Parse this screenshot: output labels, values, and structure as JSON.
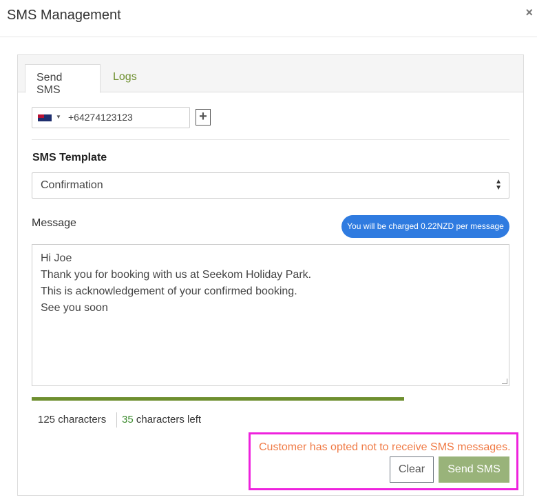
{
  "modal": {
    "title": "SMS Management",
    "close_glyph": "×"
  },
  "tabs": [
    {
      "label": "Send SMS",
      "active": true
    },
    {
      "label": "Logs",
      "active": false
    }
  ],
  "phone": {
    "country_flag": "nz-flag-icon",
    "value": "+64274123123",
    "add_glyph": "+"
  },
  "template": {
    "label": "SMS Template",
    "selected": "Confirmation"
  },
  "message": {
    "label": "Message",
    "charge_notice": "You will be charged 0.22NZD per message",
    "lines": [
      "Hi Joe",
      "Thank you for booking with us at Seekom Holiday Park.",
      "This is acknowledgement of your confirmed booking.",
      "See you soon"
    ]
  },
  "counter": {
    "used": "125 characters",
    "left_num": "35",
    "left_suffix": " characters left",
    "progress_fraction": 0.78
  },
  "alert": {
    "text": "Customer has opted not to receive SMS messages."
  },
  "actions": {
    "clear_label": "Clear",
    "send_label": "Send SMS"
  },
  "colors": {
    "accent_green": "#6e8f2f",
    "pill_blue": "#2f7be0",
    "warning_orange": "#f07a45",
    "highlight_magenta": "#ee22dd",
    "send_button": "#99b37a"
  }
}
